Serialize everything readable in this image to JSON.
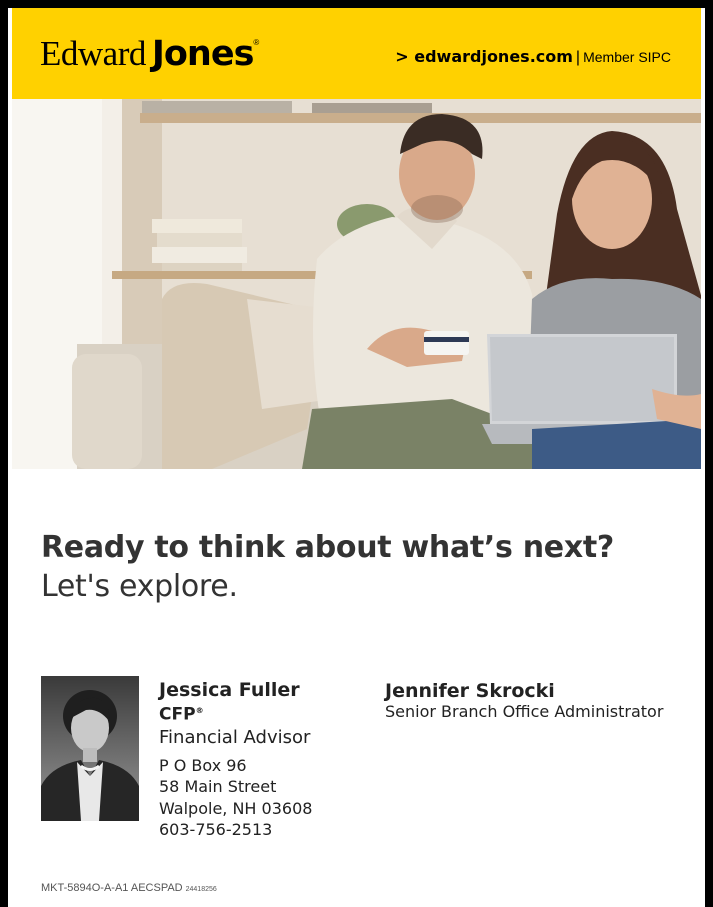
{
  "header": {
    "logo_edward": "Edward",
    "logo_jones": "Jones",
    "logo_reg": "®",
    "website": "> edwardjones.com",
    "separator": "|",
    "member": "Member SIPC"
  },
  "headline": {
    "line1": "Ready to think about what’s next?",
    "line2": "Let's explore."
  },
  "advisor": {
    "name": "Jessica Fuller",
    "credential": "CFP",
    "credential_mark": "®",
    "title": "Financial Advisor",
    "address": [
      "P O Box 96",
      "58 Main Street",
      "Walpole, NH 03608",
      "603-756-2513"
    ]
  },
  "admin": {
    "name": "Jennifer Skrocki",
    "role": "Senior Branch Office Administrator"
  },
  "footer": {
    "code": "MKT-5894O-A-A1  AECSPAD",
    "small_code": "24418256"
  },
  "colors": {
    "brand_yellow": "#FFD100",
    "text_dark": "#333333"
  }
}
